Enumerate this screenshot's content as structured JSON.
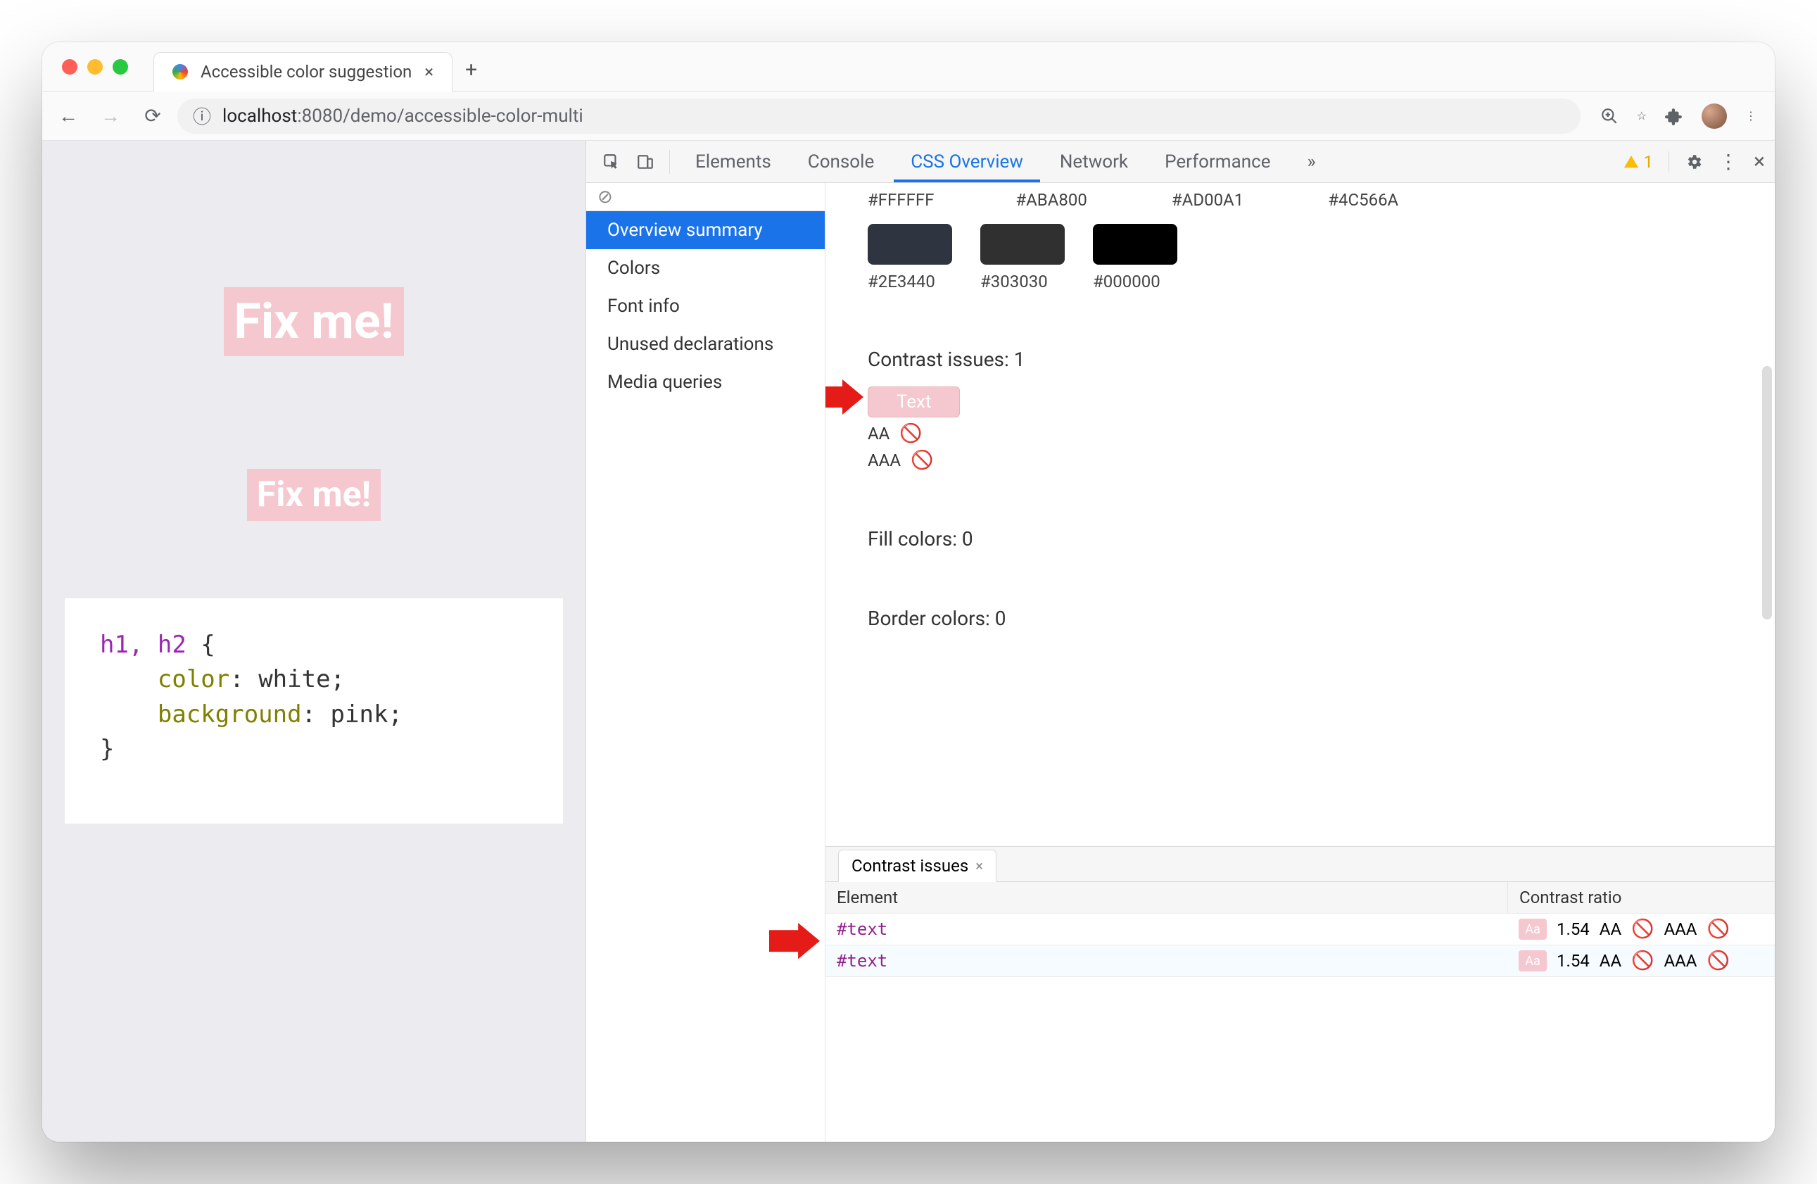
{
  "browser": {
    "tab_title": "Accessible color suggestion",
    "new_tab_glyph": "+",
    "close_glyph": "×",
    "url_host": "localhost",
    "url_port_path": ":8080/demo/accessible-color-multi",
    "info_glyph": "ⓘ",
    "zoom_icon_title": "Zoom",
    "menu_glyph": "⋮"
  },
  "page": {
    "heading1": "Fix me!",
    "heading2": "Fix me!",
    "code_selectors": "h1, h2",
    "code_open": " {",
    "code_prop_color": "color",
    "code_val_color": "white",
    "code_prop_bg": "background",
    "code_val_bg": "pink",
    "code_colon": ": ",
    "code_semicolon": ";",
    "code_close": "}"
  },
  "devtools": {
    "tabs": {
      "elements": "Elements",
      "console": "Console",
      "css_overview": "CSS Overview",
      "network": "Network",
      "performance": "Performance",
      "more_glyph": "»"
    },
    "warnings_count": "1",
    "sidebar": {
      "clear_glyph": "⊘",
      "overview_summary": "Overview summary",
      "colors": "Colors",
      "font_info": "Font info",
      "unused": "Unused declarations",
      "media": "Media queries"
    },
    "overview": {
      "color_labels_row1": [
        "#FFFFFF",
        "#ABA800",
        "#AD00A1",
        "#4C566A"
      ],
      "colors_row2": [
        {
          "label": "#2E3440",
          "hex": "#2E3440"
        },
        {
          "label": "#303030",
          "hex": "#303030"
        },
        {
          "label": "#000000",
          "hex": "#000000"
        }
      ],
      "contrast_title": "Contrast issues: 1",
      "text_pill": "Text",
      "aa_label": "AA",
      "aaa_label": "AAA",
      "no_glyph": "🚫",
      "fill_title": "Fill colors: 0",
      "border_title": "Border colors: 0"
    },
    "drawer": {
      "tab_label": "Contrast issues",
      "header_element": "Element",
      "header_ratio": "Contrast ratio",
      "rows": [
        {
          "element": "#text",
          "ratio": "1.54",
          "aa": "AA",
          "aaa": "AAA"
        },
        {
          "element": "#text",
          "ratio": "1.54",
          "aa": "AA",
          "aaa": "AAA"
        }
      ],
      "aa_chip_text": "Aa"
    }
  }
}
